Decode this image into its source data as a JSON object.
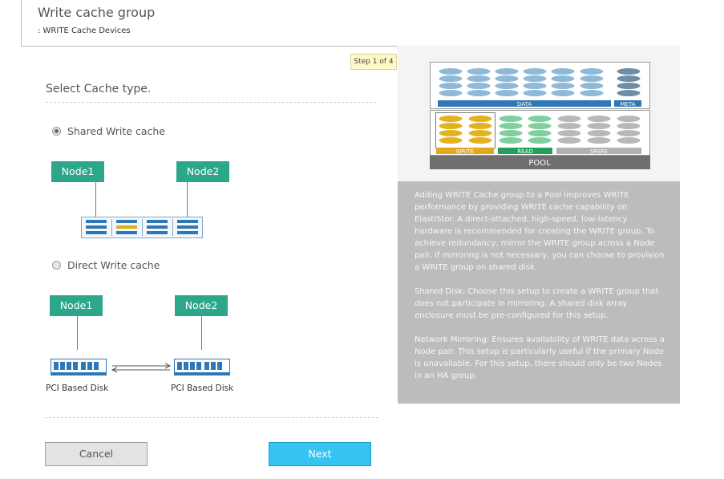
{
  "header": {
    "title": "Write cache group",
    "subtitle": ": WRITE Cache Devices"
  },
  "step_label": "Step 1 of 4",
  "section_heading": "Select Cache type.",
  "options": {
    "shared": {
      "label": "Shared Write cache",
      "selected": true
    },
    "direct": {
      "label": "Direct Write cache",
      "selected": false
    }
  },
  "diagram": {
    "node1": "Node1",
    "node2": "Node2",
    "pci_label": "PCI Based Disk"
  },
  "pool": {
    "data_label": "DATA",
    "meta_label": "META",
    "write_label": "WRITE",
    "read_label": "READ",
    "spare_label": "SPARE",
    "pool_label": "POOL",
    "colors": {
      "data": "#8fb9d9",
      "meta": "#6f8ea6",
      "write": "#e3b21c",
      "read": "#7fcf9f",
      "spare": "#b8b8b8"
    }
  },
  "info": {
    "para1": "Adding WRITE Cache group to a Pool improves WRITE performance by providing WRITE cache capability on ElastiStor. A direct-attached, high-speed, low-latency hardware is recommended for creating the WRITE group. To achieve redundancy, mirror the WRITE group across a Node pair. If mirroring is not necessary, you can choose to provision a WRITE group on shared disk.",
    "para2": "Shared Disk: Choose this setup to create a WRITE group that does not participate in mirroring. A shared disk array enclosure must be pre-configured for this setup.",
    "para3": "Network Mirroring: Ensures availability of WRITE data across a Node pair. This setup is particularly useful if the primary Node is unavailable. For this setup, there should only be two Nodes in an HA group."
  },
  "buttons": {
    "cancel": "Cancel",
    "next": "Next"
  }
}
